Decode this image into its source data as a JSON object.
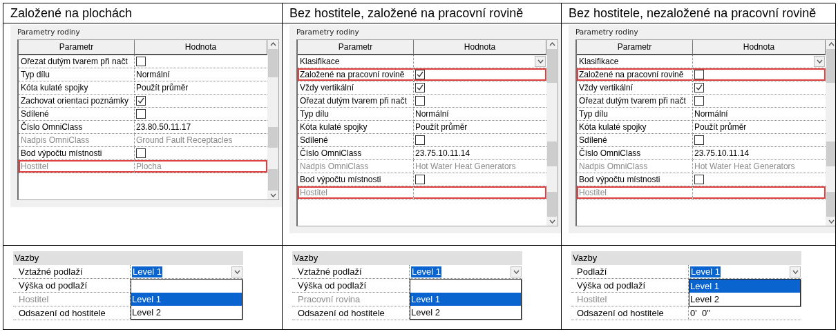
{
  "columns": [
    {
      "title": "Založené na plochách",
      "family_parameters": {
        "label": "Parametry rodiny",
        "headers": [
          "Parametr",
          "Hodnota"
        ],
        "rows": [
          {
            "name": "Ořezat dutým tvarem při načt",
            "kind": "checkbox",
            "checked": false,
            "disabled": false,
            "highlighted": false
          },
          {
            "name": "Typ dílu",
            "kind": "text",
            "value": "Normální",
            "disabled": false,
            "highlighted": false
          },
          {
            "name": "Kóta kulaté spojky",
            "kind": "text",
            "value": "Použít průměr",
            "disabled": false,
            "highlighted": false
          },
          {
            "name": "Zachovat orientaci poznámky",
            "kind": "checkbox",
            "checked": true,
            "disabled": false,
            "highlighted": false
          },
          {
            "name": "Sdílené",
            "kind": "checkbox",
            "checked": false,
            "disabled": false,
            "highlighted": false
          },
          {
            "name": "Číslo OmniClass",
            "kind": "text",
            "value": "23.80.50.11.17",
            "disabled": false,
            "highlighted": false
          },
          {
            "name": "Nadpis OmniClass",
            "kind": "text",
            "value": "Ground Fault Receptacles",
            "disabled": true,
            "highlighted": false
          },
          {
            "name": "Bod výpočtu místnosti",
            "kind": "checkbox",
            "checked": false,
            "disabled": false,
            "highlighted": false
          },
          {
            "name": "Hostitel",
            "kind": "text",
            "value": "Plocha",
            "disabled": true,
            "highlighted": true
          }
        ]
      },
      "constraints": {
        "title": "Vazby",
        "rows": [
          {
            "name": "Vztažné podlaží",
            "kind": "combo",
            "value": "Level 1",
            "disabled": false
          },
          {
            "name": "Výška od podlaží",
            "kind": "text",
            "disabled": false
          },
          {
            "name": "Hostitel",
            "kind": "text",
            "disabled": true
          },
          {
            "name": "Odsazení od hostitele",
            "kind": "text",
            "disabled": false
          }
        ],
        "dropdown": {
          "blank_option": true,
          "options": [
            {
              "label": "Level 1",
              "selected": true
            },
            {
              "label": "Level 2",
              "selected": false
            }
          ]
        }
      }
    },
    {
      "title": "Bez hostitele, založené na pracovní rovině",
      "family_parameters": {
        "label": "Parametry rodiny",
        "headers": [
          "Parametr",
          "Hodnota"
        ],
        "rows": [
          {
            "name": "Klasifikace",
            "kind": "select",
            "disabled": false,
            "highlighted": false
          },
          {
            "name": "Založené na pracovní rovině",
            "kind": "checkbox",
            "checked": true,
            "disabled": false,
            "highlighted": true
          },
          {
            "name": "Vždy vertikální",
            "kind": "checkbox",
            "checked": true,
            "disabled": false,
            "highlighted": false
          },
          {
            "name": "Ořezat dutým tvarem při načt",
            "kind": "checkbox",
            "checked": false,
            "disabled": false,
            "highlighted": false
          },
          {
            "name": "Typ dílu",
            "kind": "text",
            "value": "Normální",
            "disabled": false,
            "highlighted": false
          },
          {
            "name": "Kóta kulaté spojky",
            "kind": "text",
            "value": "Použít průměr",
            "disabled": false,
            "highlighted": false
          },
          {
            "name": "Sdílené",
            "kind": "checkbox",
            "checked": false,
            "disabled": false,
            "highlighted": false
          },
          {
            "name": "Číslo OmniClass",
            "kind": "text",
            "value": "23.75.10.11.14",
            "disabled": false,
            "highlighted": false
          },
          {
            "name": "Nadpis OmniClass",
            "kind": "text",
            "value": "Hot Water Heat Generators",
            "disabled": true,
            "highlighted": false
          },
          {
            "name": "Bod výpočtu místnosti",
            "kind": "checkbox",
            "checked": false,
            "disabled": false,
            "highlighted": false
          },
          {
            "name": "Hostitel",
            "kind": "text",
            "disabled": true,
            "highlighted": true
          }
        ]
      },
      "constraints": {
        "title": "Vazby",
        "rows": [
          {
            "name": "Vztažné podlaží",
            "kind": "combo",
            "value": "Level 1",
            "disabled": false
          },
          {
            "name": "Výška od podlaží",
            "kind": "text",
            "disabled": false
          },
          {
            "name": "Pracovní rovina",
            "kind": "text",
            "disabled": true
          },
          {
            "name": "Odsazení od hostitele",
            "kind": "text",
            "disabled": false
          }
        ],
        "dropdown": {
          "blank_option": true,
          "options": [
            {
              "label": "Level 1",
              "selected": true
            },
            {
              "label": "Level 2",
              "selected": false
            }
          ]
        }
      }
    },
    {
      "title": "Bez hostitele, nezaložené na pracovní rovině",
      "family_parameters": {
        "label": "Parametry rodiny",
        "headers": [
          "Parametr",
          "Hodnota"
        ],
        "rows": [
          {
            "name": "Klasifikace",
            "kind": "select",
            "disabled": false,
            "highlighted": false
          },
          {
            "name": "Založené na pracovní rovině",
            "kind": "checkbox",
            "checked": false,
            "disabled": false,
            "highlighted": true
          },
          {
            "name": "Vždy vertikální",
            "kind": "checkbox",
            "checked": true,
            "disabled": false,
            "highlighted": false
          },
          {
            "name": "Ořezat dutým tvarem při načt",
            "kind": "checkbox",
            "checked": false,
            "disabled": false,
            "highlighted": false
          },
          {
            "name": "Typ dílu",
            "kind": "text",
            "value": "Normální",
            "disabled": false,
            "highlighted": false
          },
          {
            "name": "Kóta kulaté spojky",
            "kind": "text",
            "value": "Použít průměr",
            "disabled": false,
            "highlighted": false
          },
          {
            "name": "Sdílené",
            "kind": "checkbox",
            "checked": false,
            "disabled": false,
            "highlighted": false
          },
          {
            "name": "Číslo OmniClass",
            "kind": "text",
            "value": "23.75.10.11.14",
            "disabled": false,
            "highlighted": false
          },
          {
            "name": "Nadpis OmniClass",
            "kind": "text",
            "value": "Hot Water Heat Generators",
            "disabled": true,
            "highlighted": false
          },
          {
            "name": "Bod výpočtu místnosti",
            "kind": "checkbox",
            "checked": false,
            "disabled": false,
            "highlighted": false
          },
          {
            "name": "Hostitel",
            "kind": "text",
            "disabled": true,
            "highlighted": true
          }
        ]
      },
      "constraints": {
        "title": "Vazby",
        "rows": [
          {
            "name": "Podlaží",
            "kind": "combo",
            "value": "Level 1",
            "disabled": false
          },
          {
            "name": "Výška od podlaží",
            "kind": "text",
            "disabled": false
          },
          {
            "name": "Hostitel",
            "kind": "text",
            "disabled": true
          },
          {
            "name": "Odsazení od hostitele",
            "kind": "text",
            "value": "0'  0\"",
            "disabled": false
          }
        ],
        "dropdown": {
          "blank_option": false,
          "options": [
            {
              "label": "Level 1",
              "selected": true
            },
            {
              "label": "Level 2",
              "selected": false
            }
          ]
        }
      }
    }
  ]
}
